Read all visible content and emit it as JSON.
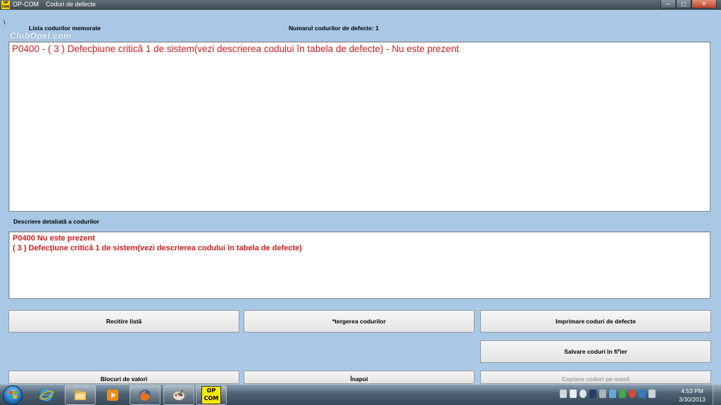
{
  "window": {
    "logo_text": "OP COM",
    "app_name": "OP-COM",
    "title": "Coduri de defecte",
    "minimize": "—",
    "maximize": "□",
    "close": "✕"
  },
  "watermark": "ClubOpel.com",
  "path_marker": "\\",
  "header": {
    "list_label": "Lista codurilor memorate",
    "count_label": "Numarul codurilor de defecte: 1"
  },
  "codes_list": [
    "P0400 - ( 3 )  Defecþiune criticã 1 de sistem(vezi descrierea codului în tabela de defecte) - Nu este prezent"
  ],
  "detail": {
    "label": "Descriere detaliatã a codurilor",
    "lines": [
      "P0400  Nu este prezent",
      "( 3 )  Defecţiune criticã 1 de sistem(vezi descrierea codului în tabela de defecte)"
    ]
  },
  "buttons": {
    "reread": "Recitire listã",
    "delete": "ªtergerea codurilor",
    "print": "Imprimare coduri de defecte",
    "save": "Salvare coduri în fiºier",
    "blocks": "Blocuri de valori",
    "back": "Înapoi",
    "copy": "Copiere coduri pe masã"
  },
  "taskbar": {
    "opcom_label": "OP COM",
    "clock_time": "4:53 PM",
    "clock_date": "3/30/2013"
  },
  "colors": {
    "background": "#a9c8e6",
    "error_text": "#d01c1c",
    "opcom_yellow": "#f6e80a"
  }
}
